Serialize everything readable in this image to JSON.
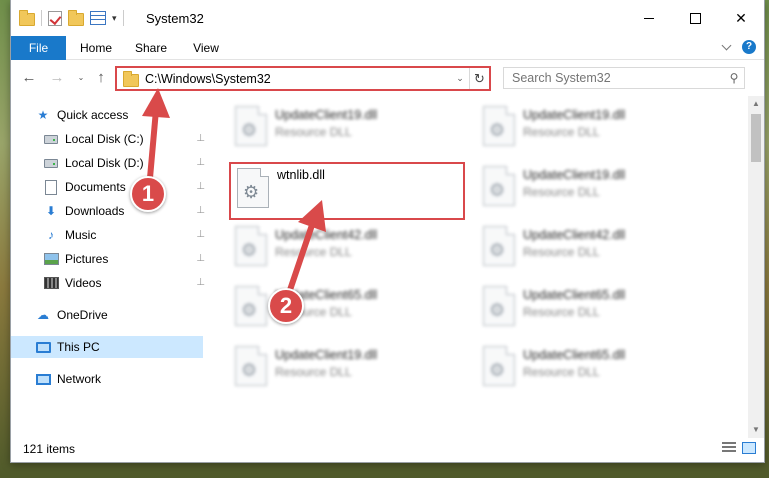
{
  "window": {
    "title": "System32",
    "qat_caret": "▾",
    "controls": {
      "close": "✕"
    }
  },
  "ribbon": {
    "tabs": [
      "File",
      "Home",
      "Share",
      "View"
    ],
    "help": "?"
  },
  "nav": {
    "back": "←",
    "forward": "→",
    "recent": "⌄",
    "up": "↑",
    "address": "C:\\Windows\\System32",
    "address_dropdown": "⌄",
    "refresh": "↻",
    "search_placeholder": "Search System32",
    "search_icon": "⚲"
  },
  "sidebar": {
    "items": [
      {
        "label": "Quick access",
        "icon": "star-icon"
      },
      {
        "label": "Local Disk (C:)",
        "icon": "drive-icon",
        "pinned": true
      },
      {
        "label": "Local Disk (D:)",
        "icon": "drive-icon",
        "pinned": true
      },
      {
        "label": "Documents",
        "icon": "documents-icon",
        "pinned": true
      },
      {
        "label": "Downloads",
        "icon": "download-icon",
        "pinned": true
      },
      {
        "label": "Music",
        "icon": "music-icon",
        "pinned": true
      },
      {
        "label": "Pictures",
        "icon": "pictures-icon",
        "pinned": true
      },
      {
        "label": "Videos",
        "icon": "videos-icon",
        "pinned": true
      },
      {
        "label": "OneDrive",
        "icon": "cloud-icon"
      },
      {
        "label": "This PC",
        "icon": "pc-icon",
        "selected": true
      },
      {
        "label": "Network",
        "icon": "network-icon"
      }
    ],
    "pin_glyph": "📌"
  },
  "files": [
    {
      "name": "UpdateClient19.dll",
      "type": "Resource DLL"
    },
    {
      "name": "UpdateClient19.dll",
      "type": "Resource DLL"
    },
    {
      "name": "wtnlib.dll",
      "type": ""
    },
    {
      "name": "UpdateClient19.dll",
      "type": "Resource DLL"
    },
    {
      "name": "UpdateClient42.dll",
      "type": "Resource DLL"
    },
    {
      "name": "UpdateClient42.dll",
      "type": "Resource DLL"
    },
    {
      "name": "UpdateClient65.dll",
      "type": "Resource DLL"
    },
    {
      "name": "UpdateClient65.dll",
      "type": "Resource DLL"
    },
    {
      "name": "UpdateClient19.dll",
      "type": "Resource DLL"
    },
    {
      "name": "UpdateClient65.dll",
      "type": "Resource DLL"
    }
  ],
  "status": {
    "items": "121 items"
  },
  "annotations": {
    "badge1": "1",
    "badge2": "2",
    "accent": "#d9484b"
  }
}
